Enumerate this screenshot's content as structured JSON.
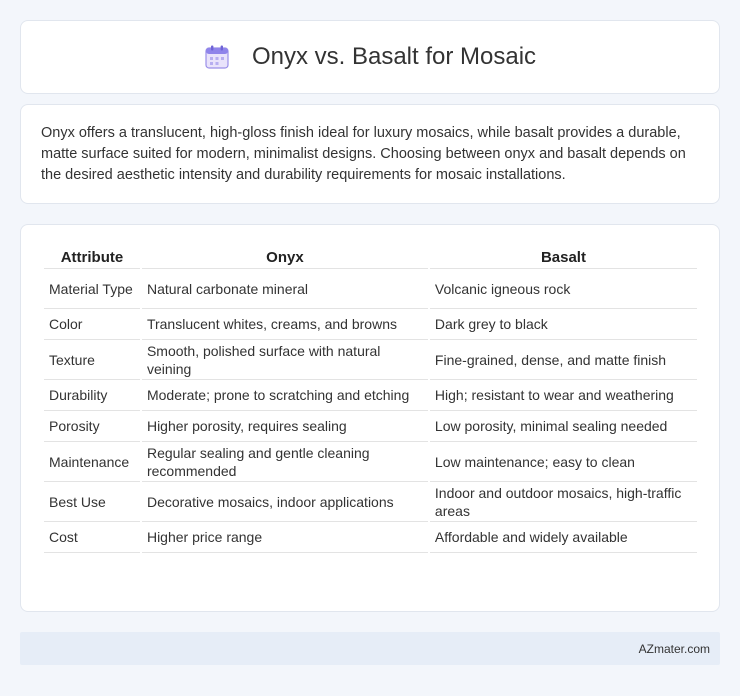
{
  "header": {
    "title": "Onyx vs. Basalt for Mosaic",
    "icon": "calendar-icon"
  },
  "intro": {
    "text": "Onyx offers a translucent, high-gloss finish ideal for luxury mosaics, while basalt provides a durable, matte surface suited for modern, minimalist designs. Choosing between onyx and basalt depends on the desired aesthetic intensity and durability requirements for mosaic installations."
  },
  "table": {
    "columns": [
      "Attribute",
      "Onyx",
      "Basalt"
    ],
    "rows": [
      [
        "Material Type",
        "Natural carbonate mineral",
        "Volcanic igneous rock"
      ],
      [
        "Color",
        "Translucent whites, creams, and browns",
        "Dark grey to black"
      ],
      [
        "Texture",
        "Smooth, polished surface with natural veining",
        "Fine-grained, dense, and matte finish"
      ],
      [
        "Durability",
        "Moderate; prone to scratching and etching",
        "High; resistant to wear and weathering"
      ],
      [
        "Porosity",
        "Higher porosity, requires sealing",
        "Low porosity, minimal sealing needed"
      ],
      [
        "Maintenance",
        "Regular sealing and gentle cleaning recommended",
        "Low maintenance; easy to clean"
      ],
      [
        "Best Use",
        "Decorative mosaics, indoor applications",
        "Indoor and outdoor mosaics, high-traffic areas"
      ],
      [
        "Cost",
        "Higher price range",
        "Affordable and widely available"
      ]
    ]
  },
  "footer": {
    "brand": "AZmater.com"
  },
  "colors": {
    "page_bg": "#f3f6fb",
    "card_bg": "#ffffff",
    "footer_bg": "#e6edf7",
    "icon_accent": "#7b6ee6"
  }
}
